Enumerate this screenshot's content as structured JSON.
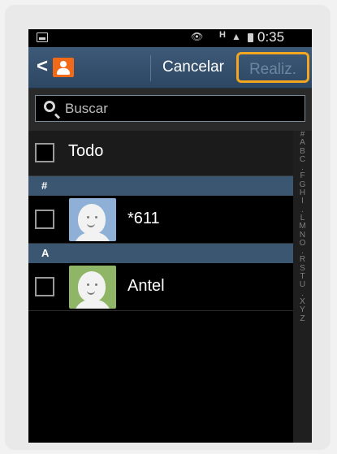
{
  "status_bar": {
    "time": "0:35",
    "network": "H"
  },
  "action_bar": {
    "cancel_label": "Cancelar",
    "done_label": "Realiz."
  },
  "search": {
    "placeholder": "Buscar"
  },
  "list": {
    "select_all_label": "Todo",
    "sections": [
      {
        "header": "#",
        "contacts": [
          {
            "name": "*611",
            "avatar_color": "#8fb0d6"
          }
        ]
      },
      {
        "header": "A",
        "contacts": [
          {
            "name": "Antel",
            "avatar_color": "#8fb566"
          }
        ]
      }
    ]
  },
  "index": {
    "letters": [
      "#",
      "A",
      "B",
      "C",
      ".",
      "F",
      "G",
      "H",
      "I",
      ".",
      "L",
      "M",
      "N",
      "O",
      ".",
      "R",
      "S",
      "T",
      "U",
      ".",
      "X",
      "Y",
      "Z"
    ]
  },
  "colors": {
    "action_bar": "#2d4763",
    "section_header": "#3b5670",
    "highlight": "#f3a61f",
    "contacts_app": "#f06a1a"
  }
}
